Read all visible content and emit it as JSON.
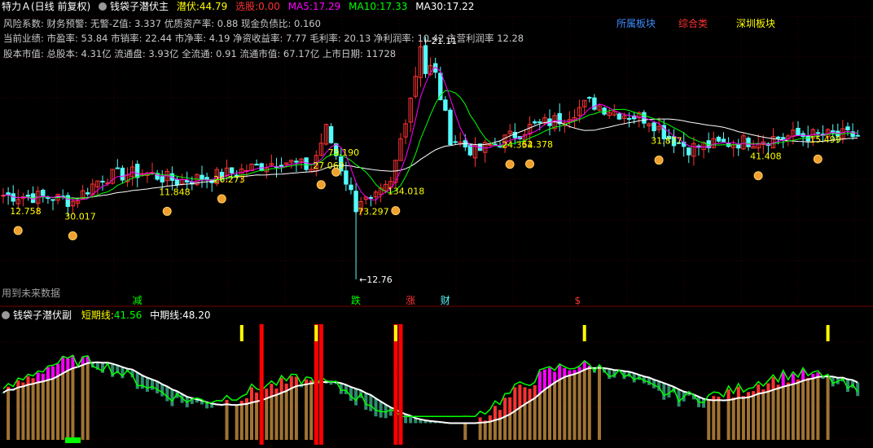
{
  "colors": {
    "up": "#ff3232",
    "down": "#54fcfc",
    "ma5": "#ff00ff",
    "ma10": "#00ff00",
    "ma30": "#ffffff",
    "yellow": "#ffff00"
  },
  "top_header": {
    "stock_title": "特力Ａ(日线 前复权)",
    "indicator_name": "钱袋子潜伏主",
    "qianfu": {
      "label": "潜伏:",
      "value": "44.79"
    },
    "xuangu": {
      "label": "选股:",
      "value": "0.00"
    },
    "ma5": {
      "label": "MA5:",
      "value": "17.29"
    },
    "ma10": {
      "label": "MA10:",
      "value": "17.33"
    },
    "ma30": {
      "label": "MA30:",
      "value": "17.22"
    }
  },
  "boards": {
    "sector": "所属板块",
    "composite": "综合类",
    "shenzhen": "深圳板块"
  },
  "info_lines": [
    "风险系数: 财务预警: 无警-Z值: 3.337 优质资产率: 0.88 现金负债比: 0.160",
    "当前业绩: 市盈率: 53.84 市销率: 22.44 市净率: 4.19 净资收益率: 7.77 毛利率: 20.13 净利润率: 10.42 主营利润率 12.28",
    "股本市值: 总股本: 4.31亿 流通盘: 3.93亿 全流通: 0.91 流通市值: 67.17亿 上市日期: 11728"
  ],
  "future_data_notice": "用到未来数据",
  "price_marks": {
    "high": "21.11",
    "low": "12.76"
  },
  "price_labels": [
    {
      "text": "12.758",
      "i": 2
    },
    {
      "text": "30.017",
      "i": 13
    },
    {
      "text": "11.848",
      "i": 32
    },
    {
      "text": "26.273",
      "i": 43
    },
    {
      "text": "27.060",
      "i": 63
    },
    {
      "text": "79.190",
      "i": 66
    },
    {
      "text": "73.297",
      "i": 72
    },
    {
      "text": "134.018",
      "i": 78
    },
    {
      "text": "24.354",
      "i": 101
    },
    {
      "text": "62.378",
      "i": 105
    },
    {
      "text": "31.877",
      "i": 131
    },
    {
      "text": "41.408",
      "i": 151
    },
    {
      "text": "15.499",
      "i": 163
    }
  ],
  "moneybag_positions": [
    2,
    13,
    32,
    43,
    63,
    66,
    78,
    101,
    105,
    131,
    151,
    163
  ],
  "event_markers": [
    {
      "text": "减",
      "i": 26,
      "color": "#00ff00"
    },
    {
      "text": "跌",
      "i": 70,
      "color": "#00ff00"
    },
    {
      "text": "涨",
      "i": 81,
      "color": "#ff3232"
    },
    {
      "text": "财",
      "i": 88,
      "color": "#54fcfc"
    },
    {
      "text": "$",
      "i": 115,
      "color": "#ff3232"
    }
  ],
  "sub_header": {
    "indicator_name": "钱袋子潜伏副",
    "short": {
      "label": "短期线:",
      "value": "41.56"
    },
    "mid": {
      "label": "中期线:",
      "value": "48.20"
    }
  }
}
